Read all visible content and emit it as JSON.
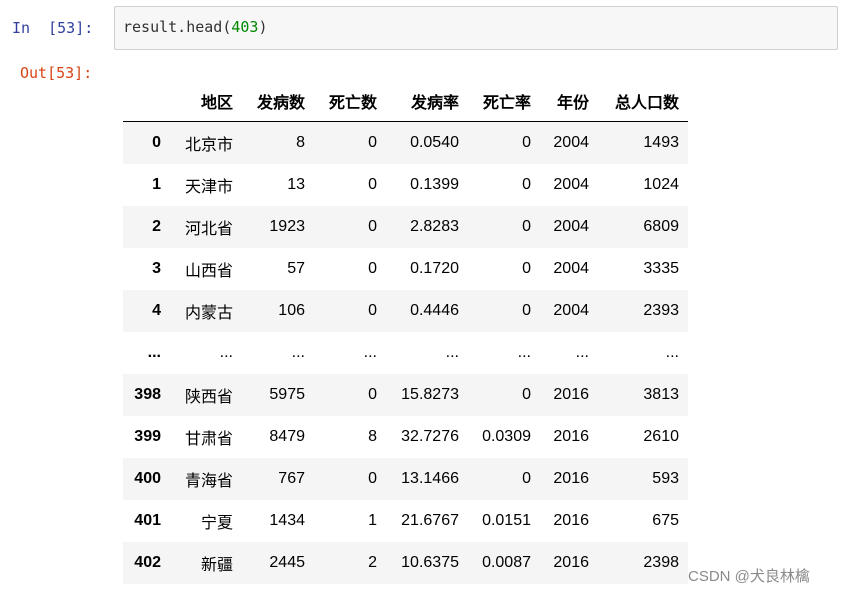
{
  "cell": {
    "in_prompt": "In  [53]:",
    "out_prompt": "Out[53]:",
    "code_func": "result.head(",
    "code_arg": "403",
    "code_close": ")"
  },
  "table": {
    "columns": [
      "地区",
      "发病数",
      "死亡数",
      "发病率",
      "死亡率",
      "年份",
      "总人口数"
    ],
    "rows": [
      {
        "index": "0",
        "cells": [
          "北京市",
          "8",
          "0",
          "0.0540",
          "0",
          "2004",
          "1493"
        ]
      },
      {
        "index": "1",
        "cells": [
          "天津市",
          "13",
          "0",
          "0.1399",
          "0",
          "2004",
          "1024"
        ]
      },
      {
        "index": "2",
        "cells": [
          "河北省",
          "1923",
          "0",
          "2.8283",
          "0",
          "2004",
          "6809"
        ]
      },
      {
        "index": "3",
        "cells": [
          "山西省",
          "57",
          "0",
          "0.1720",
          "0",
          "2004",
          "3335"
        ]
      },
      {
        "index": "4",
        "cells": [
          "内蒙古",
          "106",
          "0",
          "0.4446",
          "0",
          "2004",
          "2393"
        ]
      },
      {
        "index": "...",
        "cells": [
          "...",
          "...",
          "...",
          "...",
          "...",
          "...",
          "..."
        ]
      },
      {
        "index": "398",
        "cells": [
          "陕西省",
          "5975",
          "0",
          "15.8273",
          "0",
          "2016",
          "3813"
        ]
      },
      {
        "index": "399",
        "cells": [
          "甘肃省",
          "8479",
          "8",
          "32.7276",
          "0.0309",
          "2016",
          "2610"
        ]
      },
      {
        "index": "400",
        "cells": [
          "青海省",
          "767",
          "0",
          "13.1466",
          "0",
          "2016",
          "593"
        ]
      },
      {
        "index": "401",
        "cells": [
          "宁夏",
          "1434",
          "1",
          "21.6767",
          "0.0151",
          "2016",
          "675"
        ]
      },
      {
        "index": "402",
        "cells": [
          "新疆",
          "2445",
          "2",
          "10.6375",
          "0.0087",
          "2016",
          "2398"
        ]
      }
    ]
  },
  "watermark": "CSDN @犬良林檎"
}
